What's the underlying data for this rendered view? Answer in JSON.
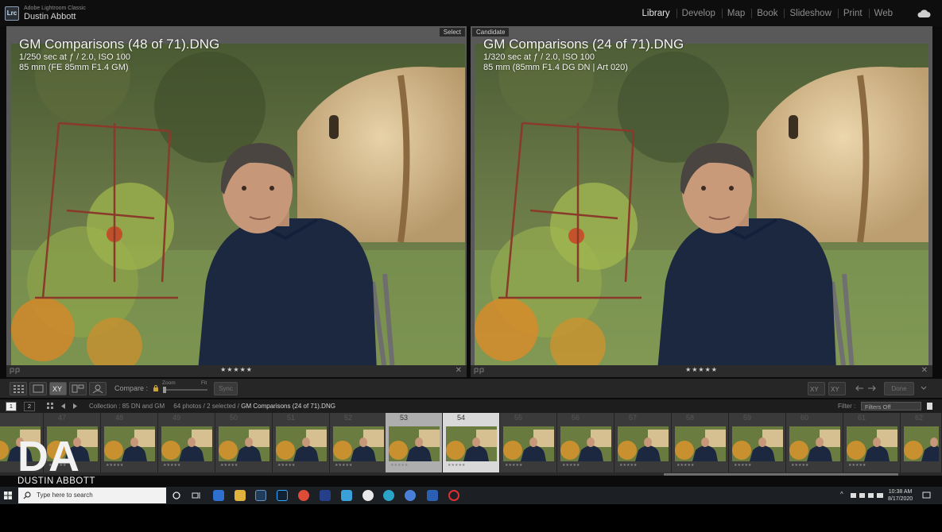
{
  "app": {
    "product": "Adobe Lightroom Classic",
    "badge": "Lrc",
    "user": "Dustin Abbott"
  },
  "modules": [
    "Library",
    "Develop",
    "Map",
    "Book",
    "Slideshow",
    "Print",
    "Web"
  ],
  "active_module": "Library",
  "compare": {
    "select": {
      "tag": "Select",
      "title": "GM Comparisons (48 of 71).DNG",
      "exposure": "1/250 sec at ƒ / 2.0, ISO 100",
      "lens": "85 mm (FE 85mm F1.4 GM)",
      "rating": "★★★★★"
    },
    "candidate": {
      "tag": "Candidate",
      "title": "GM Comparisons (24 of 71).DNG",
      "exposure": "1/320 sec at ƒ / 2.0, ISO 100",
      "lens": "85 mm (85mm F1.4 DG DN | Art 020)",
      "rating": "★★★★★"
    },
    "close": "✕"
  },
  "toolbar": {
    "compare_label": "Compare :",
    "zoom_label": "Zoom",
    "fit_label": "Fit",
    "sync_label": "Sync",
    "done_label": "Done",
    "views": [
      "grid-view",
      "loupe-view",
      "compare-view",
      "survey-view",
      "people-view"
    ]
  },
  "filmstrip": {
    "page1": "1",
    "page2": "2",
    "collection_prefix": "Collection : 85 DN and GM",
    "counts": "64 photos / 2 selected /",
    "current": "GM Comparisons (24 of 71).DNG",
    "filter_label": "Filter :",
    "filter_value": "Filters Off",
    "numbers": [
      "47",
      "48",
      "49",
      "50",
      "51",
      "52",
      "53",
      "54",
      "55",
      "56",
      "57",
      "58",
      "59",
      "60",
      "61",
      "62"
    ],
    "selected": [
      "53",
      "54"
    ]
  },
  "watermark": {
    "mark": "DA",
    "name": "DUSTIN ABBOTT"
  },
  "taskbar": {
    "search_placeholder": "Type here to search",
    "time": "10:38 AM",
    "date": "8/17/2020",
    "apps": [
      "task-view",
      "outlook",
      "file-explorer",
      "lightroom-classic",
      "photoshop",
      "chrome",
      "app-a",
      "app-b",
      "app-c",
      "edge",
      "app-d",
      "word",
      "recorder"
    ]
  }
}
